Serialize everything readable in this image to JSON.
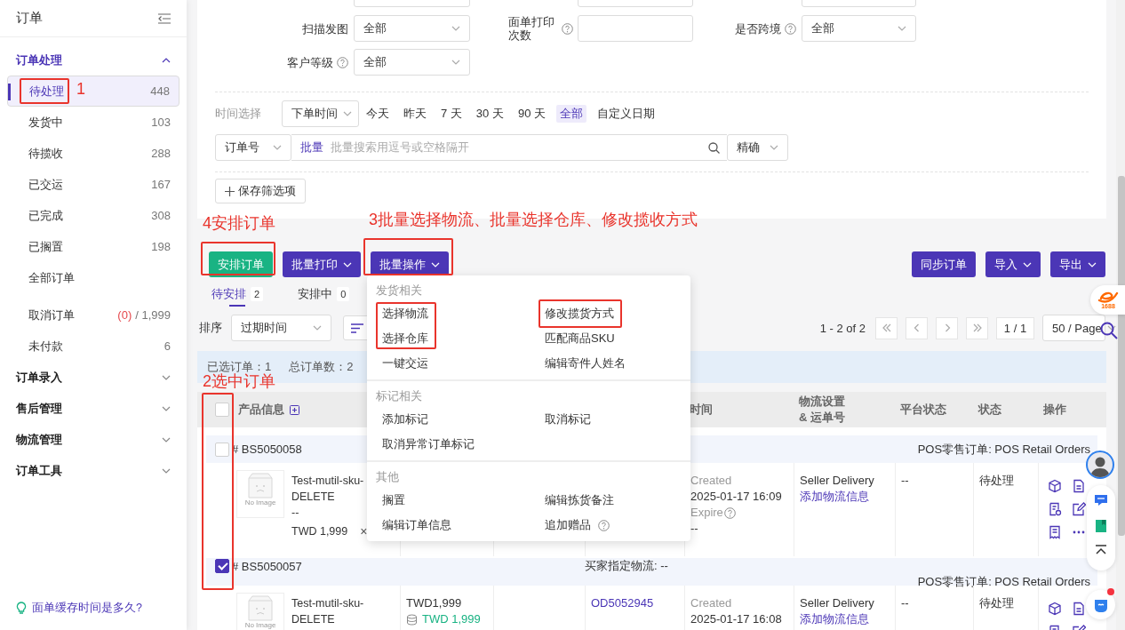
{
  "sidebar": {
    "title": "订单",
    "groups": [
      {
        "label": "订单处理",
        "expanded": true,
        "sections": [
          {
            "items": [
              {
                "label": "待处理",
                "count": "448",
                "selected": true
              },
              {
                "label": "发货中",
                "count": "103",
                "selected": false
              },
              {
                "label": "待揽收",
                "count": "288",
                "selected": false
              },
              {
                "label": "已交运",
                "count": "167",
                "selected": false
              },
              {
                "label": "已完成",
                "count": "308",
                "selected": false
              },
              {
                "label": "已搁置",
                "count": "198",
                "selected": false
              },
              {
                "label": "全部订单",
                "selected": false
              }
            ]
          },
          {
            "items": [
              {
                "label": "取消订单",
                "alert_count": "(0)",
                "count": "/ 1,999",
                "selected": false
              },
              {
                "label": "未付款",
                "count": "6",
                "selected": false
              }
            ]
          }
        ]
      },
      {
        "label": "订单录入",
        "expanded": false
      },
      {
        "label": "售后管理",
        "expanded": false
      },
      {
        "label": "物流管理",
        "expanded": false
      },
      {
        "label": "订单工具",
        "expanded": false
      }
    ],
    "help_link": "面单缓存时间是多久?"
  },
  "filters": {
    "rows": [
      [
        {
          "kind": "select"
        },
        {
          "kind": "input"
        },
        {
          "kind": "select"
        }
      ],
      [
        {
          "label": "扫描发图",
          "kind": "select",
          "value": "全部"
        },
        {
          "label": "面单打印次数",
          "help": true,
          "kind": "input"
        },
        {
          "label": "是否跨境",
          "help": true,
          "kind": "select",
          "value": "全部"
        }
      ],
      [
        {
          "label": "客户等级",
          "help": true,
          "kind": "select",
          "value": "全部"
        }
      ]
    ]
  },
  "time_filter": {
    "label": "时间选择",
    "field": "下单时间",
    "options": [
      {
        "label": "今天",
        "selected": false
      },
      {
        "label": "昨天",
        "selected": false
      },
      {
        "label": "7 天",
        "selected": false
      },
      {
        "label": "30 天",
        "selected": false
      },
      {
        "label": "90 天",
        "selected": false
      },
      {
        "label": "全部",
        "selected": true
      },
      {
        "label": "自定义日期",
        "selected": false
      }
    ]
  },
  "search": {
    "field": "订单号",
    "prefix": "批量",
    "placeholder": "批量搜索用逗号或空格隔开",
    "match": "精确"
  },
  "save_filter_button": "保存筛选项",
  "toolbar": {
    "left": [
      {
        "label": "安排订单",
        "kind": "primary"
      },
      {
        "label": "批量打印",
        "kind": "dropdown"
      },
      {
        "label": "批量操作",
        "kind": "dropdown"
      }
    ],
    "right": [
      {
        "label": "同步订单",
        "kind": "plain"
      },
      {
        "label": "导入",
        "kind": "dropdown"
      },
      {
        "label": "导出",
        "kind": "dropdown"
      }
    ]
  },
  "tabs": [
    {
      "label": "待安排",
      "count": "2",
      "selected": true
    },
    {
      "label": "安排中",
      "count": "0",
      "selected": false
    }
  ],
  "sort": {
    "label": "排序",
    "value": "过期时间"
  },
  "pagination": {
    "range": "1 - 2 of 2",
    "page": "1 / 1",
    "page_size": "50 / Page"
  },
  "selection_info": [
    "已选订单：1",
    "总订单数：2"
  ],
  "table": {
    "header_checked": false,
    "columns": [
      "产品信息",
      "时间",
      "物流设置 & 运单号",
      "平台状态",
      "状态",
      "操作"
    ]
  },
  "orders": [
    {
      "number": "# BS5050058",
      "checked": false,
      "source": "POS零售订单: POS Retail Orders",
      "product": {
        "image_text": "No Image",
        "name": "Test-mutil-sku-DELETE",
        "variant": "--",
        "price": "TWD 1,999",
        "remove": "×"
      },
      "created_label": "Created",
      "created": "2025-01-17 16:09",
      "expire_label": "Expire",
      "expire": "--",
      "logistics": "Seller Delivery",
      "logistics_link": "添加物流信息",
      "platform_status": "--",
      "status": "待处理"
    },
    {
      "number": "# BS5050057",
      "checked": true,
      "buyer_logistics": "买家指定物流: --",
      "source": "POS零售订单: POS Retail Orders",
      "product": {
        "image_text": "No Image",
        "name": "Test-mutil-sku-DELETE"
      },
      "price": "TWD1,999",
      "paid": "TWD 1,999",
      "order_no": "OD5052945",
      "created_label": "Created",
      "created": "2025-01-17 16:08",
      "logistics": "Seller Delivery",
      "logistics_link": "添加物流信息",
      "platform_status": "--",
      "status": "待处理"
    }
  ],
  "batch_menu": {
    "groups": [
      {
        "title": "发货相关",
        "items": [
          {
            "label": "选择物流"
          },
          {
            "label": "修改揽货方式"
          },
          {
            "label": "选择仓库"
          },
          {
            "label": "匹配商品SKU"
          },
          {
            "label": "一键交运"
          },
          {
            "label": "编辑寄件人姓名"
          }
        ]
      },
      {
        "title": "标记相关",
        "items": [
          {
            "label": "添加标记"
          },
          {
            "label": "取消标记"
          },
          {
            "label": "取消异常订单标记"
          }
        ]
      },
      {
        "title": "其他",
        "items": [
          {
            "label": "搁置"
          },
          {
            "label": "编辑拣货备注"
          },
          {
            "label": "编辑订单信息"
          },
          {
            "label": "追加赠品",
            "help": true
          }
        ]
      }
    ]
  },
  "float_tools": {
    "logo_text": "1688"
  },
  "annotations": [
    "1",
    "4安排订单",
    "3批量选择物流、批量选择仓库、修改揽收方式",
    "2选中订单"
  ]
}
